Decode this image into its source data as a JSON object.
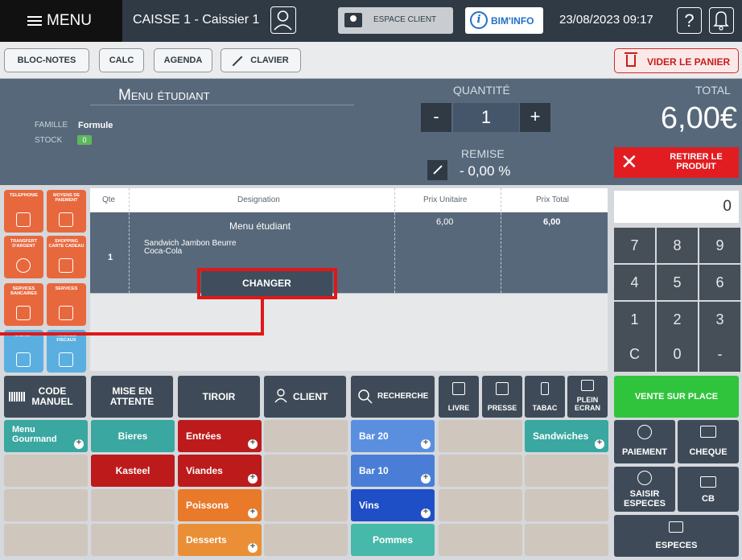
{
  "topbar": {
    "menu": "MENU",
    "caisse": "CAISSE 1 - Caissier 1",
    "espace_client": "ESPACE CLIENT",
    "biminfo": "BIM'INFO",
    "biminfo_icon": "i",
    "datetime": "23/08/2023 09:17",
    "help_icon": "?"
  },
  "toolbar": {
    "bloc_notes": "BLOC-NOTES",
    "calc": "CALC",
    "agenda": "AGENDA",
    "clavier": "CLAVIER",
    "vider": "VIDER LE PANIER"
  },
  "product": {
    "name": "Menu étudiant",
    "famille_label": "FAMILLE",
    "famille_value": "Formule",
    "stock_label": "STOCK",
    "stock_value": "0",
    "quantite_label": "QUANTITÉ",
    "quantite_minus": "-",
    "quantite_value": "1",
    "quantite_plus": "+",
    "remise_label": "REMISE",
    "remise_value": "- 0,00 %",
    "total_label": "TOTAL",
    "total_value": "6,00€",
    "retirer": "RETIRER LE PRODUIT",
    "retirer_icon": "✕"
  },
  "tiles": [
    {
      "label": "TELEPHONIE",
      "color": "#e8683d"
    },
    {
      "label": "MOYENS DE PAIEMENT",
      "color": "#e8683d"
    },
    {
      "label": "TRANSFERT D'ARGENT",
      "color": "#e8683d"
    },
    {
      "label": "SHOPPING CARTE CADEAU",
      "color": "#e8683d"
    },
    {
      "label": "SERVICES BANCAIRES",
      "color": "#e8683d"
    },
    {
      "label": "SERVICES",
      "color": "#e8683d"
    },
    {
      "label": "E-SHOP",
      "color": "#5aafe0"
    },
    {
      "label": "TIMBRES FISCAUX",
      "color": "#5aafe0"
    }
  ],
  "table": {
    "headers": [
      "Qte",
      "Designation",
      "Prix Unitaire",
      "Prix Total"
    ],
    "row": {
      "qte": "1",
      "title": "Menu étudiant",
      "items": [
        "Sandwich Jambon Beurre",
        "Coca-Cola"
      ],
      "prix_unitaire": "6,00",
      "prix_total": "6,00",
      "changer": "CHANGER"
    }
  },
  "keypad": {
    "display": "0",
    "keys": [
      "7",
      "8",
      "9",
      "4",
      "5",
      "6",
      "1",
      "2",
      "3",
      "C",
      "0",
      "-"
    ]
  },
  "functions": {
    "code_manuel": "CODE MANUEL",
    "mise_en_attente": "MISE EN ATTENTE",
    "tiroir": "TIROIR",
    "client": "CLIENT",
    "recherche": "RECHERCHE",
    "livre": "LIVRE",
    "presse": "PRESSE",
    "tabac": "TABAC",
    "plein_ecran": "PLEIN ECRAN",
    "vente_sur_place": "VENTE SUR PLACE"
  },
  "categories": {
    "menu_gourmand": "Menu Gourmand",
    "bieres": "Bieres",
    "kasteel": "Kasteel",
    "entrees": "Entrées",
    "viandes": "Viandes",
    "poissons": "Poissons",
    "desserts": "Desserts",
    "bar20": "Bar 20",
    "bar10": "Bar 10",
    "vins": "Vins",
    "pommes": "Pommes",
    "sandwiches": "Sandwiches"
  },
  "payments": {
    "paiement": "PAIEMENT",
    "cheque": "CHEQUE",
    "saisir_especes": "SAISIR ESPECES",
    "cb": "CB",
    "especes": "ESPECES"
  },
  "colors": {
    "dark": "#2f3a45",
    "panel": "#57687a",
    "accent_red": "#e11d21",
    "accent_green": "#30c43d",
    "highlight": "#e01818"
  }
}
